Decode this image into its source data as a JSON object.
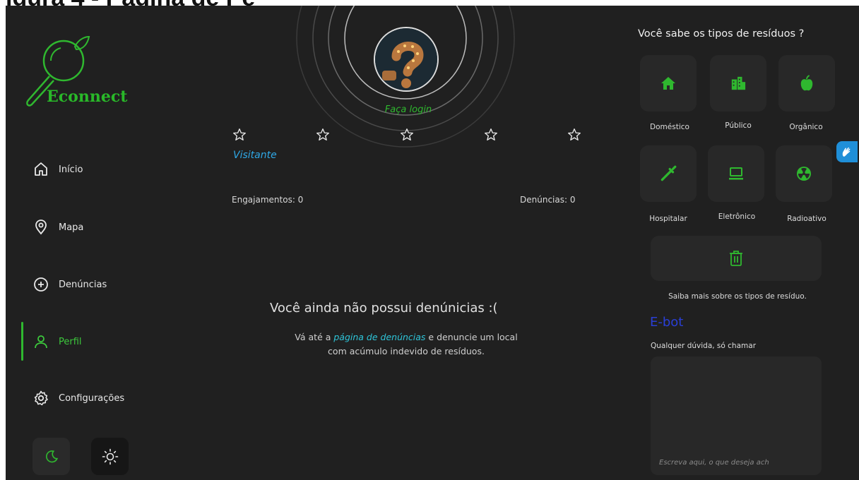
{
  "caption": "igura 4 - Página de Pe",
  "sidebar": {
    "logo_text": "Econnect",
    "items": [
      {
        "label": "Início",
        "icon": "home-icon"
      },
      {
        "label": "Mapa",
        "icon": "map-pin-icon"
      },
      {
        "label": "Denúncias",
        "icon": "plus-circle-icon"
      },
      {
        "label": "Perfil",
        "icon": "user-icon",
        "active": true
      },
      {
        "label": "Configurações",
        "icon": "gear-icon"
      }
    ],
    "theme": {
      "dark_icon": "moon-icon",
      "light_icon": "sun-icon"
    }
  },
  "profile": {
    "login_label": "Faça login",
    "username": "Visitante",
    "stars_filled": 0,
    "stars_total": 5,
    "engagements_label": "Engajamentos: 0",
    "reports_label": "Denúncias: 0"
  },
  "empty_state": {
    "title": "Você ainda não possui denúnicias :(",
    "desc_prefix": "Vá até a ",
    "desc_link": "página de denúncias",
    "desc_suffix": " e denuncie um local com acúmulo indevido de resíduos."
  },
  "waste": {
    "title": "Você sabe os tipos de resíduos ?",
    "types": [
      {
        "label": "Doméstico",
        "icon": "house-icon"
      },
      {
        "label": "Público",
        "icon": "buildings-icon"
      },
      {
        "label": "Orgânico",
        "icon": "apple-icon"
      },
      {
        "label": "Hospitalar",
        "icon": "syringe-icon"
      },
      {
        "label": "Eletrônico",
        "icon": "laptop-icon"
      },
      {
        "label": "Radioativo",
        "icon": "radiation-icon"
      }
    ],
    "learn_more": "Saiba mais sobre os tipos de resíduo."
  },
  "ebot": {
    "title": "E-bot",
    "subtitle": "Qualquer dúvida, só chamar",
    "placeholder": "Escreva aqui, o que deseja ach"
  },
  "colors": {
    "accent": "#2fb82f",
    "link": "#2ec5d9",
    "username": "#2fa8e6",
    "ebot": "#2a3fd6",
    "bg": "#202020",
    "tile": "#282828"
  }
}
